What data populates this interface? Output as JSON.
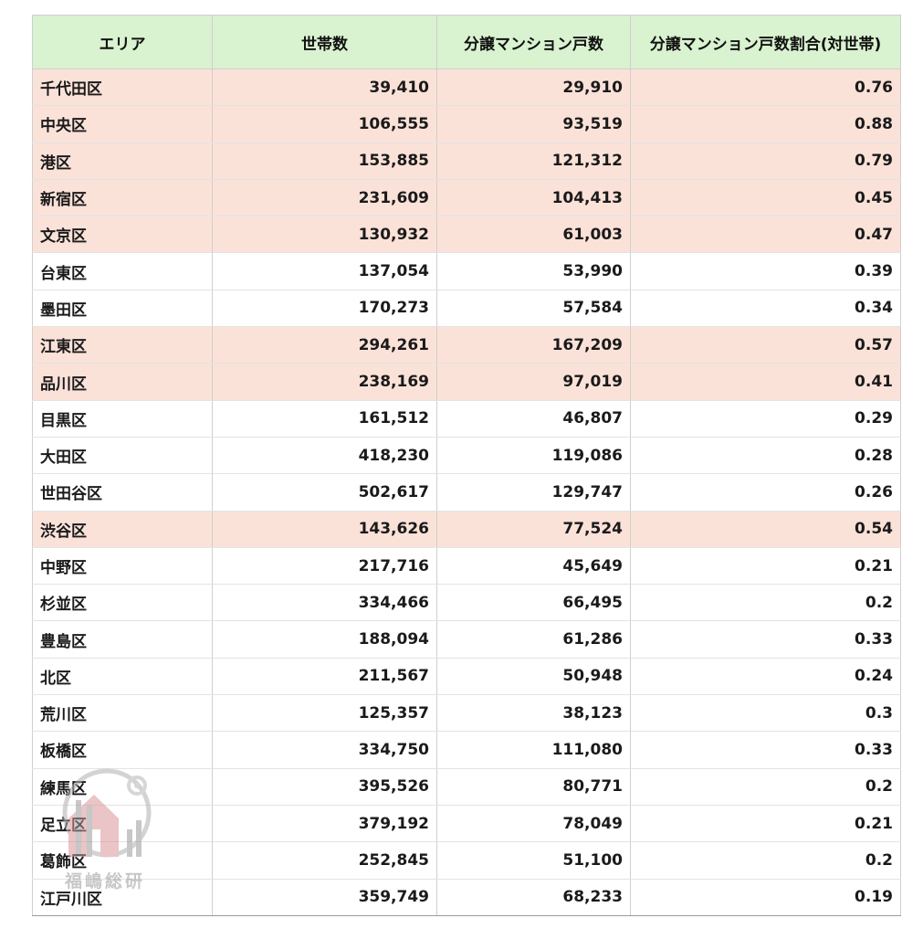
{
  "table": {
    "headers": [
      "エリア",
      "世帯数",
      "分譲マンション戸数",
      "分譲マンション戸数割合(対世帯)"
    ],
    "highlight_color": "#fbe2d9",
    "header_color": "#d9f2d0",
    "rows": [
      {
        "area": "千代田区",
        "households": "39,410",
        "condos": "29,910",
        "ratio": "0.76",
        "highlight": true
      },
      {
        "area": "中央区",
        "households": "106,555",
        "condos": "93,519",
        "ratio": "0.88",
        "highlight": true
      },
      {
        "area": "港区",
        "households": "153,885",
        "condos": "121,312",
        "ratio": "0.79",
        "highlight": true
      },
      {
        "area": "新宿区",
        "households": "231,609",
        "condos": "104,413",
        "ratio": "0.45",
        "highlight": true
      },
      {
        "area": "文京区",
        "households": "130,932",
        "condos": "61,003",
        "ratio": "0.47",
        "highlight": true
      },
      {
        "area": "台東区",
        "households": "137,054",
        "condos": "53,990",
        "ratio": "0.39",
        "highlight": false
      },
      {
        "area": "墨田区",
        "households": "170,273",
        "condos": "57,584",
        "ratio": "0.34",
        "highlight": false
      },
      {
        "area": "江東区",
        "households": "294,261",
        "condos": "167,209",
        "ratio": "0.57",
        "highlight": true
      },
      {
        "area": "品川区",
        "households": "238,169",
        "condos": "97,019",
        "ratio": "0.41",
        "highlight": true
      },
      {
        "area": "目黒区",
        "households": "161,512",
        "condos": "46,807",
        "ratio": "0.29",
        "highlight": false
      },
      {
        "area": "大田区",
        "households": "418,230",
        "condos": "119,086",
        "ratio": "0.28",
        "highlight": false
      },
      {
        "area": "世田谷区",
        "households": "502,617",
        "condos": "129,747",
        "ratio": "0.26",
        "highlight": false
      },
      {
        "area": "渋谷区",
        "households": "143,626",
        "condos": "77,524",
        "ratio": "0.54",
        "highlight": true
      },
      {
        "area": "中野区",
        "households": "217,716",
        "condos": "45,649",
        "ratio": "0.21",
        "highlight": false
      },
      {
        "area": "杉並区",
        "households": "334,466",
        "condos": "66,495",
        "ratio": "0.2",
        "highlight": false
      },
      {
        "area": "豊島区",
        "households": "188,094",
        "condos": "61,286",
        "ratio": "0.33",
        "highlight": false
      },
      {
        "area": "北区",
        "households": "211,567",
        "condos": "50,948",
        "ratio": "0.24",
        "highlight": false
      },
      {
        "area": "荒川区",
        "households": "125,357",
        "condos": "38,123",
        "ratio": "0.3",
        "highlight": false
      },
      {
        "area": "板橋区",
        "households": "334,750",
        "condos": "111,080",
        "ratio": "0.33",
        "highlight": false
      },
      {
        "area": "練馬区",
        "households": "395,526",
        "condos": "80,771",
        "ratio": "0.2",
        "highlight": false
      },
      {
        "area": "足立区",
        "households": "379,192",
        "condos": "78,049",
        "ratio": "0.21",
        "highlight": false
      },
      {
        "area": "葛飾区",
        "households": "252,845",
        "condos": "51,100",
        "ratio": "0.2",
        "highlight": false
      },
      {
        "area": "江戸川区",
        "households": "359,749",
        "condos": "68,233",
        "ratio": "0.19",
        "highlight": false
      }
    ]
  },
  "watermark": {
    "text": "福嶋総研",
    "icon": "house-gear-logo-icon"
  }
}
